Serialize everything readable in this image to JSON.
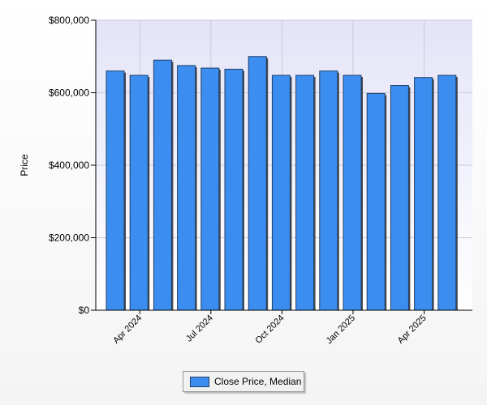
{
  "chart_data": {
    "type": "bar",
    "title": "",
    "xlabel": "",
    "ylabel": "Price",
    "ylim": [
      0,
      800000
    ],
    "y_ticks": [
      0,
      200000,
      400000,
      600000,
      800000
    ],
    "y_tick_labels": [
      "$0",
      "$200,000",
      "$400,000",
      "$600,000",
      "$800,000"
    ],
    "categories": [
      "2024-03",
      "2024-04",
      "2024-05",
      "2024-06",
      "2024-07",
      "2024-08",
      "2024-09",
      "2024-10",
      "2024-11",
      "2024-12",
      "2025-01",
      "2025-02",
      "2025-03",
      "2025-04",
      "2025-05"
    ],
    "x_tick_labels": [
      {
        "category": "2024-04",
        "label": "Apr 2024"
      },
      {
        "category": "2024-07",
        "label": "Jul 2024"
      },
      {
        "category": "2024-10",
        "label": "Oct 2024"
      },
      {
        "category": "2025-01",
        "label": "Jan 2025"
      },
      {
        "category": "2025-04",
        "label": "Apr 2025"
      }
    ],
    "series": [
      {
        "name": "Close Price, Median",
        "color": "#3c8df0",
        "values": [
          660000,
          648000,
          690000,
          675000,
          668000,
          665000,
          700000,
          648000,
          648000,
          660000,
          648000,
          598000,
          620000,
          642000,
          648000
        ]
      }
    ],
    "grid": true,
    "legend": "bottom-center",
    "plot_background": "#e8e8f8"
  },
  "legend": {
    "label": "Close Price, Median"
  }
}
